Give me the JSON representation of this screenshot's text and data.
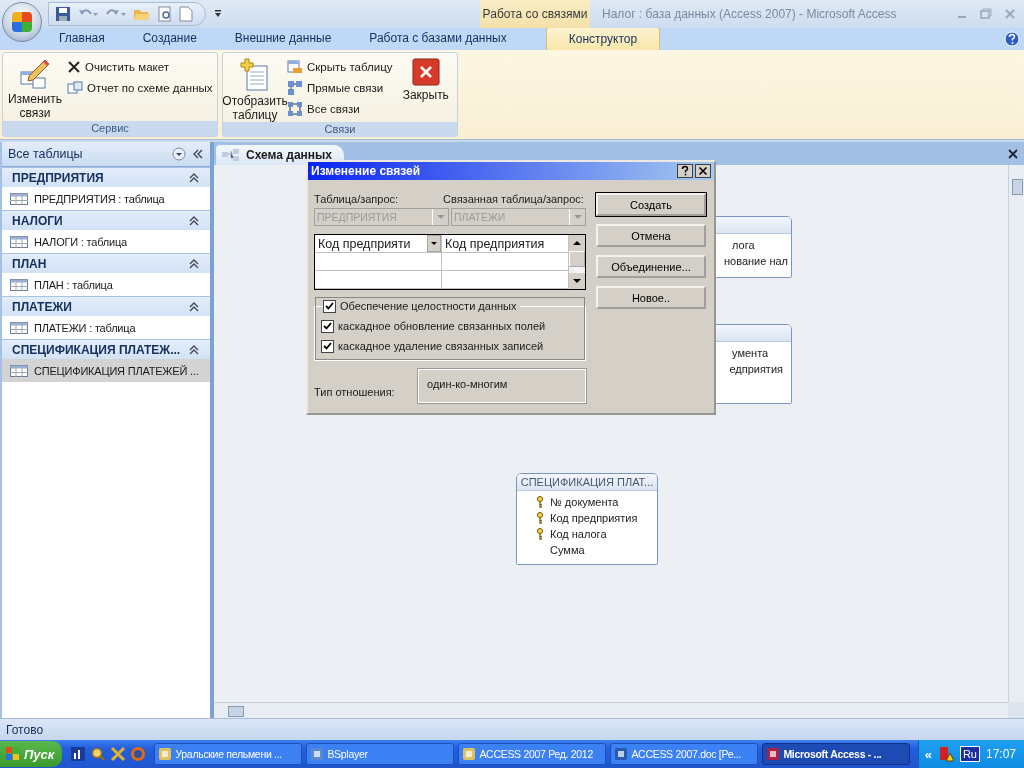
{
  "window": {
    "title": "Налог : база данных (Access 2007) - Microsoft Access"
  },
  "contextual_tab": {
    "label": "Работа со связями"
  },
  "ribbon_tabs": [
    {
      "label": "Главная",
      "selected": false
    },
    {
      "label": "Создание",
      "selected": false
    },
    {
      "label": "Внешние данные",
      "selected": false
    },
    {
      "label": "Работа с базами данных",
      "selected": false
    },
    {
      "label": "Конструктор",
      "selected": true
    }
  ],
  "ribbon_groups": [
    {
      "label": "Сервис",
      "commands": [
        {
          "kind": "large",
          "label": "Изменить связи"
        },
        {
          "kind": "small",
          "label": "Очистить макет"
        },
        {
          "kind": "small",
          "label": "Отчет по схеме данных"
        }
      ]
    },
    {
      "label": "Связи",
      "commands": [
        {
          "kind": "large",
          "label": "Отобразить таблицу"
        },
        {
          "kind": "small",
          "label": "Скрыть таблицу"
        },
        {
          "kind": "small",
          "label": "Прямые связи"
        },
        {
          "kind": "small",
          "label": "Все связи"
        },
        {
          "kind": "large",
          "label": "Закрыть"
        }
      ]
    }
  ],
  "navigation_pane": {
    "title": "Все таблицы",
    "groups": [
      {
        "title": "ПРЕДПРИЯТИЯ",
        "expanded": true,
        "items": [
          {
            "label": "ПРЕДПРИЯТИЯ : таблица",
            "selected": false
          }
        ]
      },
      {
        "title": "НАЛОГИ",
        "expanded": true,
        "items": [
          {
            "label": "НАЛОГИ : таблица",
            "selected": false
          }
        ]
      },
      {
        "title": "ПЛАН",
        "expanded": true,
        "items": [
          {
            "label": "ПЛАН : таблица",
            "selected": false
          }
        ]
      },
      {
        "title": "ПЛАТЕЖИ",
        "expanded": true,
        "items": [
          {
            "label": "ПЛАТЕЖИ : таблица",
            "selected": false
          }
        ]
      },
      {
        "title": "СПЕЦИФИКАЦИЯ ПЛАТЕЖ...",
        "expanded": true,
        "items": [
          {
            "label": "СПЕЦИФИКАЦИЯ ПЛАТЕЖЕЙ ...",
            "selected": true
          }
        ]
      }
    ]
  },
  "document_tab": {
    "label": "Схема данных"
  },
  "diagram_tables": [
    {
      "fields": [
        {
          "label": "лога"
        },
        {
          "label": "нование нал"
        }
      ]
    },
    {
      "fields": [
        {
          "label": "умента"
        },
        {
          "label": "едприятия"
        }
      ]
    },
    {
      "title": "СПЕЦИФИКАЦИЯ ПЛАТ...",
      "fields": [
        {
          "label": "№ документа",
          "key": true
        },
        {
          "label": "Код предприятия",
          "key": true
        },
        {
          "label": "Код налога",
          "key": true
        },
        {
          "label": "Сумма",
          "key": false
        }
      ]
    }
  ],
  "dialog": {
    "title": "Изменение связей",
    "table_label": "Таблица/запрос:",
    "related_label": "Связанная таблица/запрос:",
    "table": {
      "value": "ПРЕДПРИЯТИЯ",
      "disabled": true
    },
    "related_table": {
      "value": "ПЛАТЕЖИ",
      "disabled": true
    },
    "field_pairs": [
      {
        "left": "Код предприяти",
        "right": "Код предприятия"
      }
    ],
    "checkboxes": [
      {
        "label": "Обеспечение целостности данных",
        "checked": true
      },
      {
        "label": "каскадное обновление связанных полей",
        "checked": true
      },
      {
        "label": "каскадное удаление связанных записей",
        "checked": true
      }
    ],
    "relation_type_label": "Тип отношения:",
    "relation_type": "один-ко-многим",
    "buttons": [
      {
        "label": "Создать",
        "default": true
      },
      {
        "label": "Отмена",
        "default": false
      },
      {
        "label": "Объединение...",
        "default": false
      },
      {
        "label": "Новое..",
        "default": false
      }
    ]
  },
  "status_bar": {
    "text": "Готово"
  },
  "taskbar": {
    "start": "Пуск",
    "tasks": [
      {
        "label": "Уральские пельмени ...",
        "selected": false
      },
      {
        "label": "BSplayer",
        "selected": false
      },
      {
        "label": "ACCESS 2007 Ред. 2012",
        "selected": false
      },
      {
        "label": "ACCESS 2007.doc [Ре...",
        "selected": false
      },
      {
        "label": "Microsoft Access - ...",
        "selected": true
      }
    ],
    "tray_toggle": "«",
    "language": "Ru",
    "clock": "17:07"
  }
}
